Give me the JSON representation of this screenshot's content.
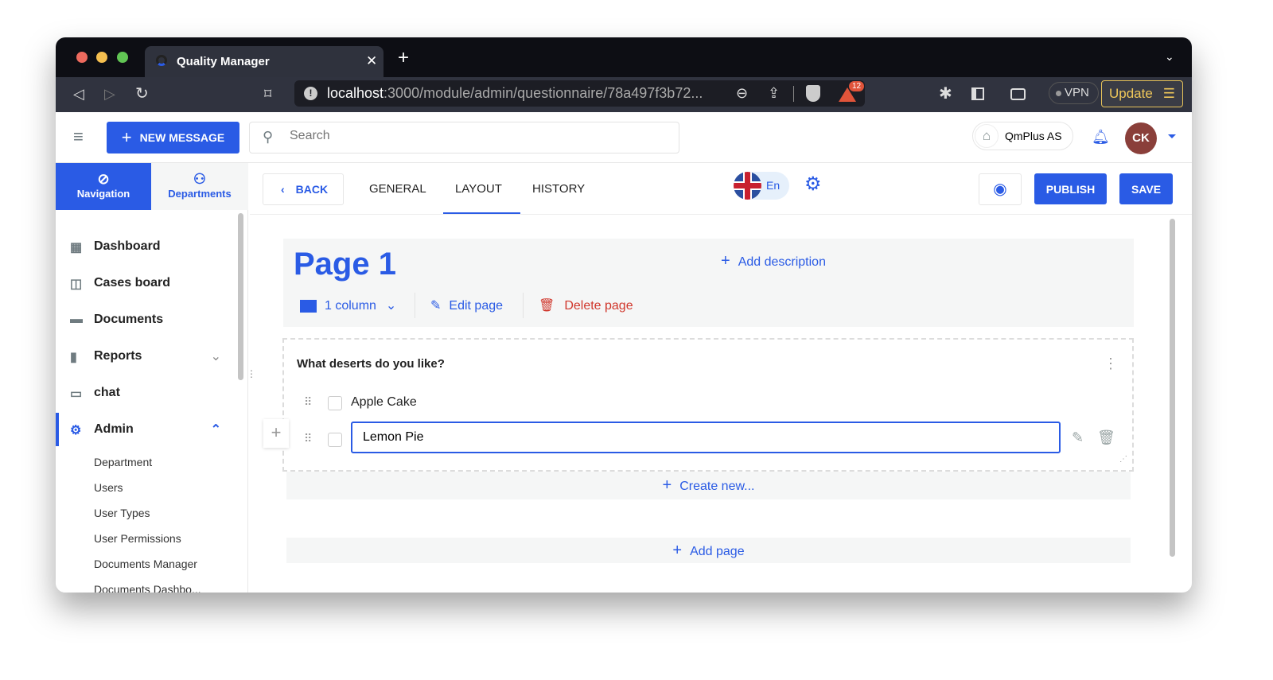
{
  "browser": {
    "tab_title": "Quality Manager",
    "url_host": "localhost",
    "url_path": ":3000/module/admin/questionnaire/78a497f3b72...",
    "badge_count": "12",
    "vpn_label": "VPN",
    "update_label": "Update"
  },
  "header": {
    "new_message": "NEW MESSAGE",
    "search_placeholder": "Search",
    "company": "QmPlus AS",
    "avatar_initials": "CK"
  },
  "sidebar": {
    "tabs": [
      {
        "label": "Navigation"
      },
      {
        "label": "Departments"
      }
    ],
    "items": [
      {
        "label": "Dashboard"
      },
      {
        "label": "Cases board"
      },
      {
        "label": "Documents"
      },
      {
        "label": "Reports"
      },
      {
        "label": "chat"
      },
      {
        "label": "Admin"
      }
    ],
    "admin_sub": [
      "Department",
      "Users",
      "User Types",
      "User Permissions",
      "Documents Manager",
      "Documents Dashbo..."
    ]
  },
  "toolbar": {
    "back": "BACK",
    "tabs": [
      "GENERAL",
      "LAYOUT",
      "HISTORY"
    ],
    "active_tab": "LAYOUT",
    "language": "En",
    "publish": "PUBLISH",
    "save": "SAVE"
  },
  "page": {
    "title": "Page 1",
    "add_description": "Add description",
    "columns": "1 column",
    "edit_page": "Edit page",
    "delete_page": "Delete page"
  },
  "question": {
    "text": "What deserts do you like?",
    "options": [
      {
        "label": "Apple Cake"
      },
      {
        "label": "Lemon Pie"
      }
    ],
    "create_new": "Create new...",
    "add_page": "Add page"
  },
  "colors": {
    "accent": "#2a5be5",
    "danger": "#d0362b",
    "avatar": "#8a3f3a"
  }
}
